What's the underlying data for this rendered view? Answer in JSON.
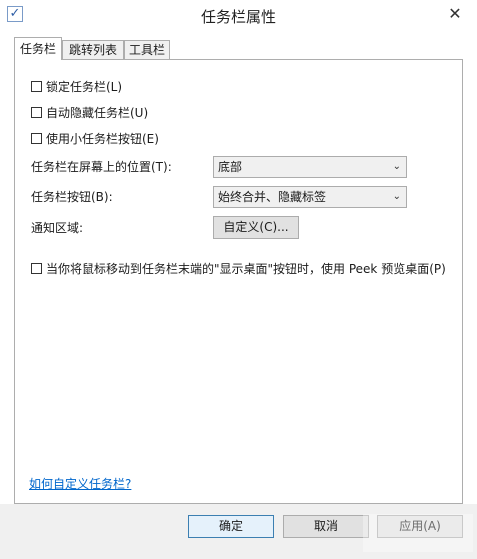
{
  "window": {
    "title": "任务栏属性",
    "close": "✕"
  },
  "tabs": [
    {
      "label": "任务栏",
      "active": true
    },
    {
      "label": "跳转列表",
      "active": false
    },
    {
      "label": "工具栏",
      "active": false
    }
  ],
  "options": {
    "lock": {
      "label": "锁定任务栏(L)",
      "checked": false
    },
    "autohide": {
      "label": "自动隐藏任务栏(U)",
      "checked": false
    },
    "small_buttons": {
      "label": "使用小任务栏按钮(E)",
      "checked": false
    },
    "peek": {
      "label": "当你将鼠标移动到任务栏末端的\"显示桌面\"按钮时，使用 Peek 预览桌面(P)",
      "checked": false
    }
  },
  "location": {
    "label": "任务栏在屏幕上的位置(T):",
    "value": "底部"
  },
  "buttons_mode": {
    "label": "任务栏按钮(B):",
    "value": "始终合并、隐藏标签"
  },
  "notification": {
    "label": "通知区域:",
    "button": "自定义(C)..."
  },
  "help_link": "如何自定义任务栏?",
  "footer": {
    "ok": "确定",
    "cancel": "取消",
    "apply": "应用(A)"
  }
}
